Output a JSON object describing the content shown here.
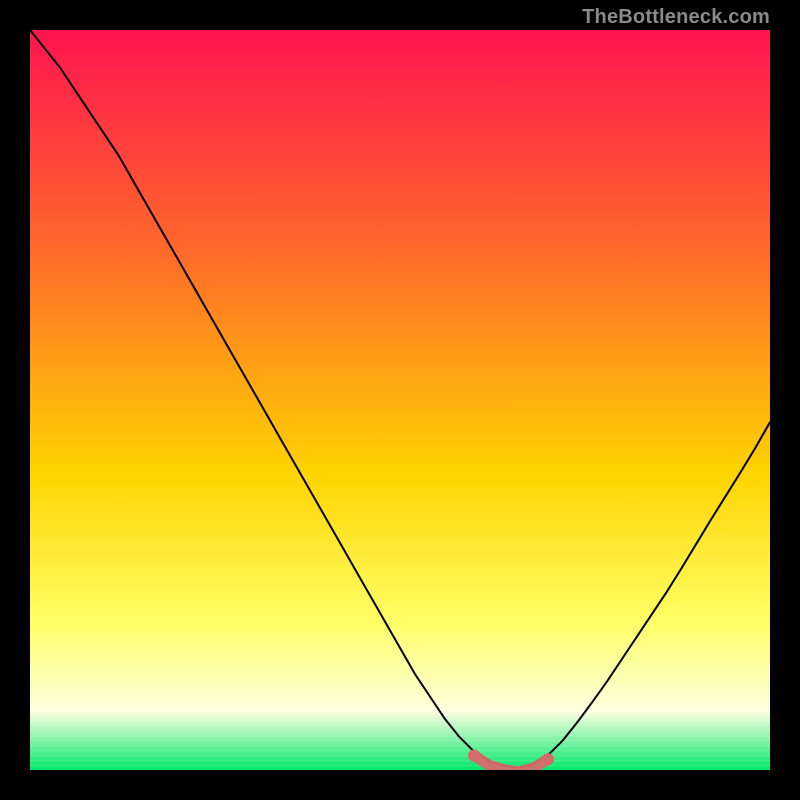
{
  "attribution": "TheBottleneck.com",
  "colors": {
    "background_black": "#000000",
    "gradient_top": "#ff1450",
    "gradient_upper": "#ff6a2a",
    "gradient_mid": "#ffd400",
    "gradient_lower": "#ffff66",
    "gradient_cream": "#ffffe0",
    "gradient_base": "#00e86a",
    "curve_stroke": "#000000",
    "marker_stroke": "#d66a6a"
  },
  "chart_data": {
    "type": "line",
    "title": "",
    "xlabel": "",
    "ylabel": "",
    "xlim": [
      0,
      100
    ],
    "ylim": [
      0,
      100
    ],
    "x": [
      0,
      2,
      4,
      6,
      8,
      10,
      12,
      14,
      16,
      18,
      20,
      22,
      24,
      26,
      28,
      30,
      32,
      34,
      36,
      38,
      40,
      42,
      44,
      46,
      48,
      50,
      52,
      54,
      56,
      58,
      60,
      62,
      64,
      66,
      68,
      70,
      72,
      74,
      76,
      78,
      80,
      82,
      84,
      86,
      88,
      90,
      92,
      94,
      96,
      98,
      100
    ],
    "values": [
      100,
      97.5,
      95,
      92,
      89,
      86,
      83,
      79.5,
      76,
      72.5,
      69,
      65.5,
      62,
      58.5,
      55,
      51.5,
      48,
      44.5,
      41,
      37.5,
      34,
      30.5,
      27,
      23.5,
      20,
      16.5,
      13,
      10,
      7,
      4.5,
      2.5,
      1.2,
      0.6,
      0.3,
      0.8,
      2,
      4,
      6.5,
      9.2,
      12,
      15,
      18,
      21,
      24,
      27.2,
      30.5,
      33.8,
      37,
      40.2,
      43.5,
      47
    ],
    "highlight_x_range": [
      60,
      70
    ],
    "gradient_stops": [
      {
        "offset": 0.0,
        "key": "gradient_top"
      },
      {
        "offset": 0.3,
        "key": "gradient_upper"
      },
      {
        "offset": 0.6,
        "key": "gradient_mid"
      },
      {
        "offset": 0.8,
        "key": "gradient_lower"
      },
      {
        "offset": 0.92,
        "key": "gradient_cream"
      },
      {
        "offset": 1.0,
        "key": "gradient_base"
      }
    ]
  }
}
